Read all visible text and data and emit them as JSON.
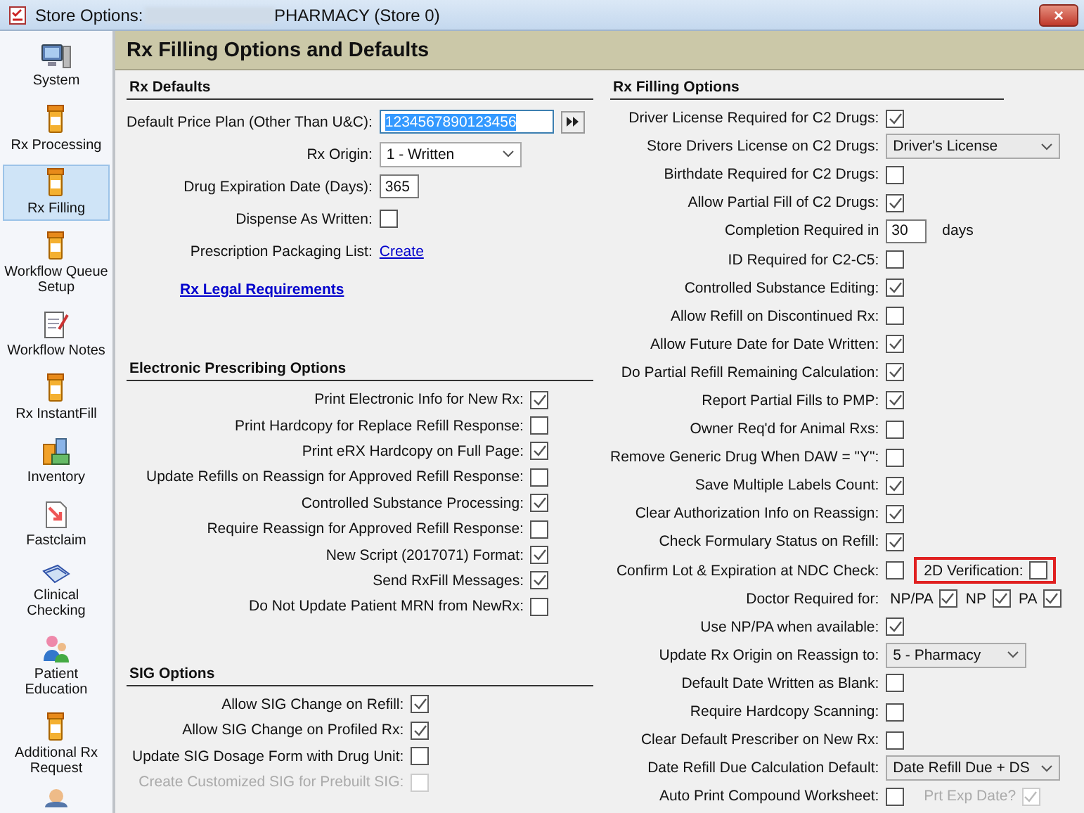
{
  "window": {
    "title": "Store Options:",
    "subtitle": "PHARMACY (Store 0)",
    "close": "×"
  },
  "sidebar": {
    "items": [
      {
        "label": "System",
        "selected": false
      },
      {
        "label": "Rx Processing",
        "selected": false
      },
      {
        "label": "Rx Filling",
        "selected": true
      },
      {
        "label": "Workflow Queue Setup",
        "selected": false
      },
      {
        "label": "Workflow Notes",
        "selected": false
      },
      {
        "label": "Rx InstantFill",
        "selected": false
      },
      {
        "label": "Inventory",
        "selected": false
      },
      {
        "label": "Fastclaim",
        "selected": false
      },
      {
        "label": "Clinical Checking",
        "selected": false
      },
      {
        "label": "Patient Education",
        "selected": false
      },
      {
        "label": "Additional Rx Request",
        "selected": false
      }
    ]
  },
  "page_title": "Rx Filling Options and Defaults",
  "left_sections": [
    {
      "title": "Rx Defaults",
      "rows": [
        {
          "kind": "lookup",
          "label": "Default Price Plan (Other Than U&C):",
          "value": "1234567890123456",
          "highlighted": true
        },
        {
          "kind": "select",
          "label": "Rx Origin:",
          "value": "1 - Written"
        },
        {
          "kind": "text",
          "label": "Drug Expiration Date (Days):",
          "value": "365"
        },
        {
          "kind": "check",
          "label": "Dispense As Written:",
          "checked": false
        },
        {
          "kind": "link",
          "label": "Prescription Packaging List:",
          "value": "Create"
        }
      ],
      "link": "Rx Legal Requirements"
    },
    {
      "title": "Electronic Prescribing Options",
      "rows": [
        {
          "kind": "check",
          "label": "Print Electronic Info for New Rx:",
          "checked": true
        },
        {
          "kind": "check",
          "label": "Print Hardcopy for Replace Refill Response:",
          "checked": false
        },
        {
          "kind": "check",
          "label": "Print eRX Hardcopy on Full Page:",
          "checked": true
        },
        {
          "kind": "check",
          "label": "Update Refills on Reassign for Approved Refill Response:",
          "checked": false
        },
        {
          "kind": "check",
          "label": "Controlled Substance Processing:",
          "checked": true
        },
        {
          "kind": "check",
          "label": "Require Reassign for Approved Refill Response:",
          "checked": false
        },
        {
          "kind": "check",
          "label": "New Script (2017071) Format:",
          "checked": true
        },
        {
          "kind": "check",
          "label": "Send RxFill Messages:",
          "checked": true
        },
        {
          "kind": "check",
          "label": "Do Not Update Patient MRN from NewRx:",
          "checked": false
        }
      ]
    },
    {
      "title": "SIG Options",
      "rows": [
        {
          "kind": "check",
          "label": "Allow SIG Change on Refill:",
          "checked": true
        },
        {
          "kind": "check",
          "label": "Allow SIG Change on Profiled Rx:",
          "checked": true
        },
        {
          "kind": "check",
          "label": "Update SIG Dosage Form with Drug Unit:",
          "checked": false
        },
        {
          "kind": "check",
          "label": "Create Customized SIG for Prebuilt SIG:",
          "checked": false,
          "disabled": true
        }
      ]
    }
  ],
  "right_section": {
    "title": "Rx Filling Options",
    "rows": [
      {
        "kind": "check",
        "label": "Driver License Required for C2 Drugs:",
        "checked": true
      },
      {
        "kind": "select",
        "label": "Store Drivers License on C2 Drugs:",
        "value": "Driver's License"
      },
      {
        "kind": "check",
        "label": "Birthdate Required for C2 Drugs:",
        "checked": false
      },
      {
        "kind": "check",
        "label": "Allow Partial Fill of C2 Drugs:",
        "checked": true
      },
      {
        "kind": "number",
        "label": "Completion Required in",
        "value": "30",
        "suffix": "days"
      },
      {
        "kind": "check",
        "label": "ID Required for C2-C5:",
        "checked": false
      },
      {
        "kind": "check",
        "label": "Controlled Substance Editing:",
        "checked": true
      },
      {
        "kind": "check",
        "label": "Allow Refill on Discontinued Rx:",
        "checked": false
      },
      {
        "kind": "check",
        "label": "Allow Future Date for Date Written:",
        "checked": true
      },
      {
        "kind": "check",
        "label": "Do Partial Refill Remaining Calculation:",
        "checked": true
      },
      {
        "kind": "check",
        "label": "Report Partial Fills to PMP:",
        "checked": true
      },
      {
        "kind": "check",
        "label": "Owner Req'd for Animal Rxs:",
        "checked": false
      },
      {
        "kind": "check",
        "label": "Remove Generic Drug When DAW = \"Y\":",
        "checked": false
      },
      {
        "kind": "check",
        "label": "Save Multiple Labels Count:",
        "checked": true
      },
      {
        "kind": "check",
        "label": "Clear Authorization Info on Reassign:",
        "checked": true
      },
      {
        "kind": "check",
        "label": "Check Formulary Status on Refill:",
        "checked": true
      },
      {
        "kind": "check",
        "label": "Confirm Lot & Expiration at NDC Check:",
        "checked": false,
        "extra": {
          "label": "2D Verification:",
          "checked": false,
          "highlighted": true
        }
      },
      {
        "kind": "multi",
        "label": "Doctor Required for:",
        "options": [
          {
            "label": "NP/PA",
            "checked": true
          },
          {
            "label": "NP",
            "checked": true
          },
          {
            "label": "PA",
            "checked": true
          }
        ]
      },
      {
        "kind": "check",
        "label": "Use NP/PA when available:",
        "checked": true
      },
      {
        "kind": "select",
        "label": "Update Rx Origin on Reassign to:",
        "value": "5 - Pharmacy"
      },
      {
        "kind": "check",
        "label": "Default Date Written as Blank:",
        "checked": false
      },
      {
        "kind": "check",
        "label": "Require Hardcopy Scanning:",
        "checked": false
      },
      {
        "kind": "check",
        "label": "Clear Default Prescriber on New Rx:",
        "checked": false
      },
      {
        "kind": "select",
        "label": "Date Refill Due Calculation Default:",
        "value": "Date Refill Due + DS"
      },
      {
        "kind": "check",
        "label": "Auto Print Compound Worksheet:",
        "checked": false,
        "extra": {
          "label": "Prt Exp Date?",
          "checked": true,
          "disabled": true
        }
      }
    ]
  }
}
